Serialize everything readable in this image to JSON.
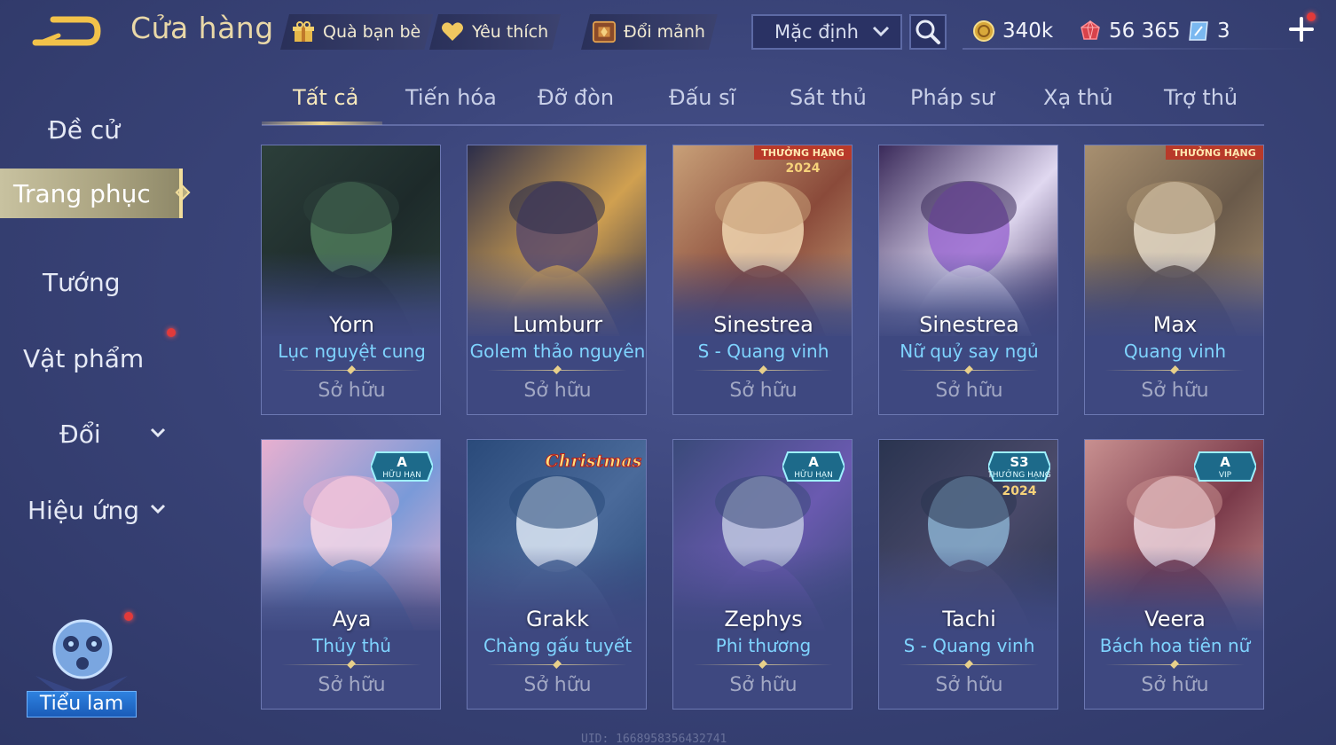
{
  "header": {
    "title": "Cửa hàng",
    "tabs": [
      {
        "label": "Quà bạn bè",
        "icon": "gift-icon"
      },
      {
        "label": "Yêu thích",
        "icon": "heart-icon"
      },
      {
        "label": "Đổi mảnh",
        "icon": "shard-chest-icon"
      }
    ],
    "sort": {
      "selected": "Mặc định"
    },
    "currencies": [
      {
        "value": "340k",
        "icon": "gold-coin-icon"
      },
      {
        "value": "56 365",
        "icon": "red-gem-icon"
      },
      {
        "value": "3",
        "icon": "voucher-icon"
      }
    ]
  },
  "sidebar": {
    "items": [
      {
        "label": "Đề cử"
      },
      {
        "label": "Trang phục"
      },
      {
        "label": "Tướng"
      },
      {
        "label": "Vật phẩm"
      },
      {
        "label": "Đổi"
      },
      {
        "label": "Hiệu ứng"
      }
    ],
    "mascot_label": "Tiểu lam"
  },
  "categories": [
    "Tất cả",
    "Tiến hóa",
    "Đỡ đòn",
    "Đấu sĩ",
    "Sát thủ",
    "Pháp sư",
    "Xạ thủ",
    "Trợ thủ"
  ],
  "skins": [
    {
      "hero": "Yorn",
      "skin": "Lục nguyệt cung",
      "status": "Sở hữu",
      "colors": [
        "#2c3f3a",
        "#4f7a5a",
        "#1d2a2a"
      ]
    },
    {
      "hero": "Lumburr",
      "skin": "Golem thảo nguyên",
      "status": "Sở hữu",
      "colors": [
        "#2b2d4a",
        "#5a4a6a",
        "#d0a050"
      ]
    },
    {
      "hero": "Sinestrea",
      "skin": "S - Quang vinh",
      "status": "Sở hữu",
      "colors": [
        "#c8a078",
        "#f0d6b0",
        "#8a4a3a"
      ],
      "badge_top": "THƯỞNG HẠNG",
      "badge_year": "2024"
    },
    {
      "hero": "Sinestrea",
      "skin": "Nữ quỷ say ngủ",
      "status": "Sở hữu",
      "colors": [
        "#3a2a5a",
        "#9a6ad0",
        "#e0d8f0"
      ]
    },
    {
      "hero": "Max",
      "skin": "Quang vinh",
      "status": "Sở hữu",
      "colors": [
        "#a89070",
        "#e8dcc8",
        "#6a5a4a"
      ],
      "badge_top": "THƯỞNG HẠNG"
    },
    {
      "hero": "Aya",
      "skin": "Thủy thủ",
      "status": "Sở hữu",
      "colors": [
        "#e8b0d0",
        "#f8d8e8",
        "#7a9ad8"
      ],
      "badge_tier": "A",
      "badge_sub": "HỮU HẠN"
    },
    {
      "hero": "Grakk",
      "skin": "Chàng gấu tuyết",
      "status": "Sở hữu",
      "colors": [
        "#2a4a7a",
        "#dde8f4",
        "#4a6a9a"
      ],
      "badge_text": "Christmas"
    },
    {
      "hero": "Zephys",
      "skin": "Phi thương",
      "status": "Sở hữu",
      "colors": [
        "#3a4a7a",
        "#c0c8e0",
        "#6a5ab0"
      ],
      "badge_tier": "A",
      "badge_sub": "HỮU HẠN"
    },
    {
      "hero": "Tachi",
      "skin": "S - Quang vinh",
      "status": "Sở hữu",
      "colors": [
        "#2a3450",
        "#8ab0d0",
        "#4a4a6a"
      ],
      "badge_tier": "S3",
      "badge_sub": "THƯỞNG HẠNG",
      "badge_year": "2024"
    },
    {
      "hero": "Veera",
      "skin": "Bách hoa tiên nữ",
      "status": "Sở hữu",
      "colors": [
        "#c89090",
        "#f0d8e0",
        "#7a3a4a"
      ],
      "badge_tier": "A",
      "badge_sub": "VIP"
    }
  ],
  "footer_uid": "UID: 1668958356432741"
}
